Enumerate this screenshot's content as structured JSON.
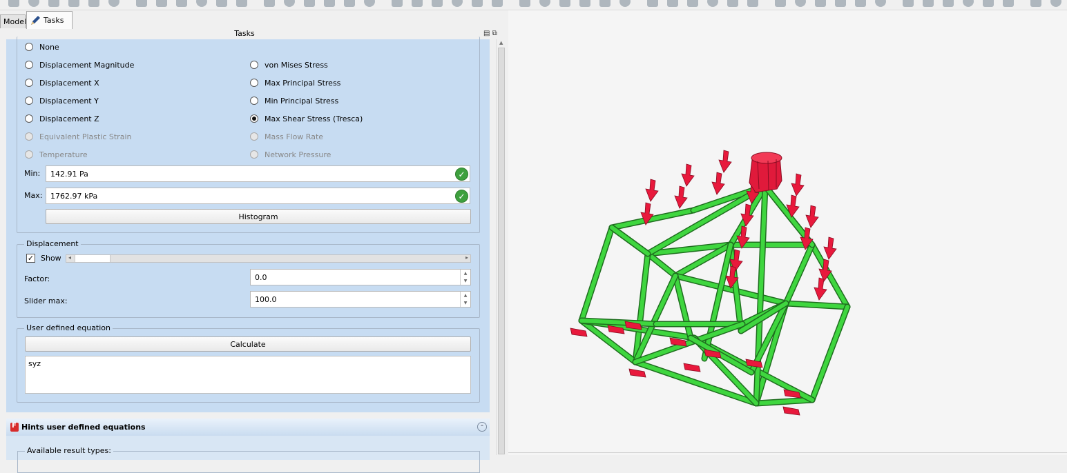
{
  "tabs": {
    "model": "Model",
    "tasks": "Tasks"
  },
  "panel_title": "Tasks",
  "result_types": {
    "left": [
      {
        "label": "None",
        "checked": false,
        "enabled": true
      },
      {
        "label": "Displacement Magnitude",
        "checked": false,
        "enabled": true
      },
      {
        "label": "Displacement X",
        "checked": false,
        "enabled": true
      },
      {
        "label": "Displacement Y",
        "checked": false,
        "enabled": true
      },
      {
        "label": "Displacement Z",
        "checked": false,
        "enabled": true
      },
      {
        "label": "Equivalent Plastic Strain",
        "checked": false,
        "enabled": false
      },
      {
        "label": "Temperature",
        "checked": false,
        "enabled": false
      }
    ],
    "right": [
      {
        "label": "von Mises Stress",
        "checked": false,
        "enabled": true
      },
      {
        "label": "Max Principal Stress",
        "checked": false,
        "enabled": true
      },
      {
        "label": "Min Principal Stress",
        "checked": false,
        "enabled": true
      },
      {
        "label": "Max Shear Stress (Tresca)",
        "checked": true,
        "enabled": true
      },
      {
        "label": "Mass Flow Rate",
        "checked": false,
        "enabled": false
      },
      {
        "label": "Network Pressure",
        "checked": false,
        "enabled": false
      }
    ]
  },
  "min": {
    "label": "Min:",
    "value": "142.91 Pa"
  },
  "max": {
    "label": "Max:",
    "value": "1762.97 kPa"
  },
  "histogram_label": "Histogram",
  "displacement": {
    "title": "Displacement",
    "show_label": "Show",
    "show_checked": true,
    "factor_label": "Factor:",
    "factor_value": "0.0",
    "slider_max_label": "Slider max:",
    "slider_max_value": "100.0"
  },
  "user_equation": {
    "title": "User defined equation",
    "calculate_label": "Calculate",
    "equation_text": "syz"
  },
  "hints": {
    "title": "Hints user defined equations",
    "group_title": "Available result types:"
  },
  "colors": {
    "panel_bg": "#c7dcf2",
    "mesh_green": "#3fd63f",
    "load_red": "#e8193c"
  }
}
